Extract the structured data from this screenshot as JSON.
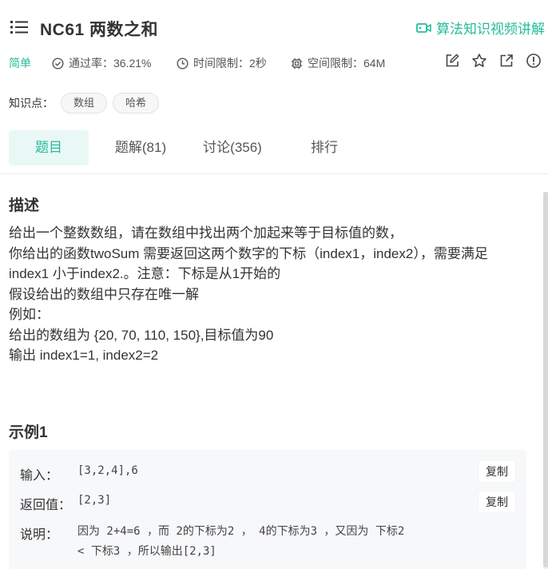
{
  "problem": {
    "id_title": "NC61  两数之和",
    "video_link": "算法知识视频讲解",
    "difficulty": "简单",
    "pass_rate": "通过率：36.21%",
    "time_limit": "时间限制：2秒",
    "space_limit": "空间限制：64M"
  },
  "tags": {
    "label": "知识点：",
    "items": [
      "数组",
      "哈希"
    ]
  },
  "tabs": [
    {
      "label": "题目",
      "active": true
    },
    {
      "label": "题解(81)",
      "active": false
    },
    {
      "label": "讨论(356)",
      "active": false
    },
    {
      "label": "排行",
      "active": false
    }
  ],
  "description": {
    "title": "描述",
    "lines": [
      "给出一个整数数组，请在数组中找出两个加起来等于目标值的数，",
      "你给出的函数twoSum 需要返回这两个数字的下标（index1，index2），需要满足",
      "index1 小于index2.。注意：下标是从1开始的",
      "假设给出的数组中只存在唯一解",
      "例如：",
      "给出的数组为 {20, 70, 110, 150},目标值为90",
      "输出 index1=1, index2=2"
    ]
  },
  "example": {
    "title": "示例1",
    "input_label": "输入：",
    "input_value": "[3,2,4],6",
    "output_label": "返回值：",
    "output_value": "[2,3]",
    "explain_label": "说明：",
    "explain_line1": "因为 2+4=6 ，而 2的下标为2 ， 4的下标为3 ，又因为 下标2",
    "explain_line2": "< 下标3 ，所以输出[2,3]",
    "copy_label": "复制"
  },
  "colors": {
    "accent": "#25bb9b",
    "tab_active_bg": "#eaf8f5",
    "example_bg": "#f7f8fa"
  }
}
